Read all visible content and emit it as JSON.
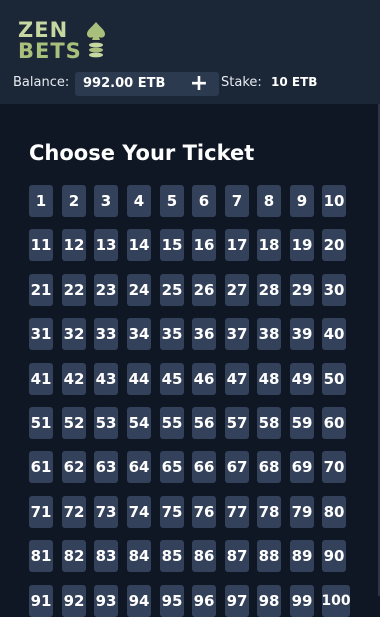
{
  "logo": {
    "line1": "ZEN",
    "line2": "BETS"
  },
  "balance": {
    "label": "Balance:",
    "value": "992.00 ETB",
    "add_symbol": "+"
  },
  "stake": {
    "label": "Stake:",
    "value": "10 ETB"
  },
  "ticket": {
    "title": "Choose Your Ticket"
  },
  "numbers": [
    "1",
    "2",
    "3",
    "4",
    "5",
    "6",
    "7",
    "8",
    "9",
    "10",
    "11",
    "12",
    "13",
    "14",
    "15",
    "16",
    "17",
    "18",
    "19",
    "20",
    "21",
    "22",
    "23",
    "24",
    "25",
    "26",
    "27",
    "28",
    "29",
    "30",
    "31",
    "32",
    "33",
    "34",
    "35",
    "36",
    "37",
    "38",
    "39",
    "40",
    "41",
    "42",
    "43",
    "44",
    "45",
    "46",
    "47",
    "48",
    "49",
    "50",
    "51",
    "52",
    "53",
    "54",
    "55",
    "56",
    "57",
    "58",
    "59",
    "60",
    "61",
    "62",
    "63",
    "64",
    "65",
    "66",
    "67",
    "68",
    "69",
    "70",
    "71",
    "72",
    "73",
    "74",
    "75",
    "76",
    "77",
    "78",
    "79",
    "80",
    "81",
    "82",
    "83",
    "84",
    "85",
    "86",
    "87",
    "88",
    "89",
    "90",
    "91",
    "92",
    "93",
    "94",
    "95",
    "96",
    "97",
    "98",
    "99",
    "100"
  ],
  "colors": {
    "header_bg": "#1b2636",
    "page_bg": "#0f1725",
    "tile_bg": "#34415a",
    "logo_green": "#c7d7a2"
  }
}
